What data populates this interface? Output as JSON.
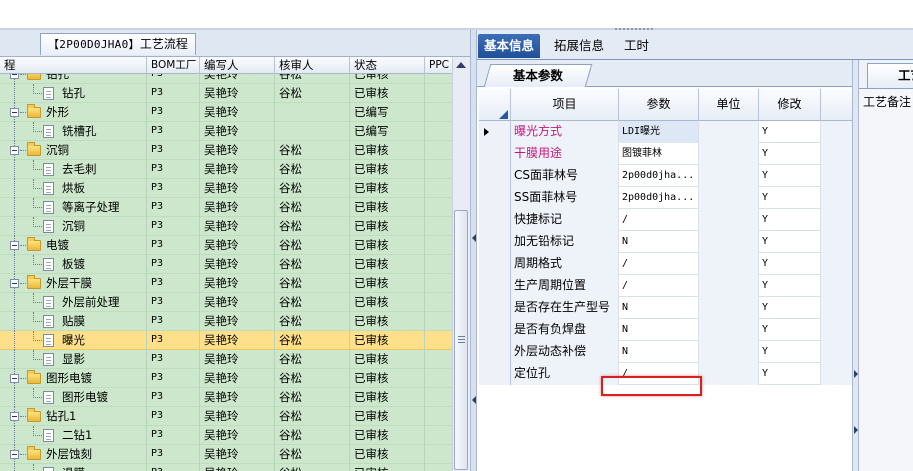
{
  "left_panel": {
    "title_code": "【2P00D0JHA0】",
    "title_text": "工艺流程",
    "columns": [
      "程",
      "BOM工厂",
      "编写人",
      "核审人",
      "状态",
      "PPC"
    ],
    "rows": [
      {
        "label": "钻孔",
        "type": "folder",
        "level": 0,
        "bom": "P3",
        "writer": "吴艳玲",
        "reviewer": "谷松",
        "status": "已审核",
        "selected": false
      },
      {
        "label": "钻孔",
        "type": "doc",
        "level": 1,
        "bom": "P3",
        "writer": "吴艳玲",
        "reviewer": "谷松",
        "status": "已审核",
        "selected": false
      },
      {
        "label": "外形",
        "type": "folder",
        "level": 0,
        "bom": "P3",
        "writer": "吴艳玲",
        "reviewer": "",
        "status": "已编写",
        "selected": false
      },
      {
        "label": "铣槽孔",
        "type": "doc",
        "level": 1,
        "bom": "P3",
        "writer": "吴艳玲",
        "reviewer": "",
        "status": "已编写",
        "selected": false
      },
      {
        "label": "沉铜",
        "type": "folder",
        "level": 0,
        "bom": "P3",
        "writer": "吴艳玲",
        "reviewer": "谷松",
        "status": "已审核",
        "selected": false
      },
      {
        "label": "去毛刺",
        "type": "doc",
        "level": 1,
        "bom": "P3",
        "writer": "吴艳玲",
        "reviewer": "谷松",
        "status": "已审核",
        "selected": false
      },
      {
        "label": "烘板",
        "type": "doc",
        "level": 1,
        "bom": "P3",
        "writer": "吴艳玲",
        "reviewer": "谷松",
        "status": "已审核",
        "selected": false
      },
      {
        "label": "等离子处理",
        "type": "doc",
        "level": 1,
        "bom": "P3",
        "writer": "吴艳玲",
        "reviewer": "谷松",
        "status": "已审核",
        "selected": false
      },
      {
        "label": "沉铜",
        "type": "doc",
        "level": 1,
        "bom": "P3",
        "writer": "吴艳玲",
        "reviewer": "谷松",
        "status": "已审核",
        "selected": false
      },
      {
        "label": "电镀",
        "type": "folder",
        "level": 0,
        "bom": "P3",
        "writer": "吴艳玲",
        "reviewer": "谷松",
        "status": "已审核",
        "selected": false
      },
      {
        "label": "板镀",
        "type": "doc",
        "level": 1,
        "bom": "P3",
        "writer": "吴艳玲",
        "reviewer": "谷松",
        "status": "已审核",
        "selected": false
      },
      {
        "label": "外层干膜",
        "type": "folder",
        "level": 0,
        "bom": "P3",
        "writer": "吴艳玲",
        "reviewer": "谷松",
        "status": "已审核",
        "selected": false
      },
      {
        "label": "外层前处理",
        "type": "doc",
        "level": 1,
        "bom": "P3",
        "writer": "吴艳玲",
        "reviewer": "谷松",
        "status": "已审核",
        "selected": false
      },
      {
        "label": "贴膜",
        "type": "doc",
        "level": 1,
        "bom": "P3",
        "writer": "吴艳玲",
        "reviewer": "谷松",
        "status": "已审核",
        "selected": false
      },
      {
        "label": "曝光",
        "type": "doc",
        "level": 1,
        "bom": "P3",
        "writer": "吴艳玲",
        "reviewer": "谷松",
        "status": "已审核",
        "selected": true
      },
      {
        "label": "显影",
        "type": "doc",
        "level": 1,
        "bom": "P3",
        "writer": "吴艳玲",
        "reviewer": "谷松",
        "status": "已审核",
        "selected": false
      },
      {
        "label": "图形电镀",
        "type": "folder",
        "level": 0,
        "bom": "P3",
        "writer": "吴艳玲",
        "reviewer": "谷松",
        "status": "已审核",
        "selected": false
      },
      {
        "label": "图形电镀",
        "type": "doc",
        "level": 1,
        "bom": "P3",
        "writer": "吴艳玲",
        "reviewer": "谷松",
        "status": "已审核",
        "selected": false
      },
      {
        "label": "钻孔1",
        "type": "folder",
        "level": 0,
        "bom": "P3",
        "writer": "吴艳玲",
        "reviewer": "谷松",
        "status": "已审核",
        "selected": false
      },
      {
        "label": "二钻1",
        "type": "doc",
        "level": 1,
        "bom": "P3",
        "writer": "吴艳玲",
        "reviewer": "谷松",
        "status": "已审核",
        "selected": false
      },
      {
        "label": "外层蚀刻",
        "type": "folder",
        "level": 0,
        "bom": "P3",
        "writer": "吴艳玲",
        "reviewer": "谷松",
        "status": "已审核",
        "selected": false
      },
      {
        "label": "退膜",
        "type": "doc",
        "level": 1,
        "bom": "P3",
        "writer": "吴艳玲",
        "reviewer": "谷松",
        "status": "已审核",
        "selected": false
      }
    ]
  },
  "right_panel": {
    "tabs": [
      "基本信息",
      "拓展信息",
      "工时"
    ],
    "active_tab": "基本信息",
    "sub_tab": "基本参数",
    "columns": [
      "项目",
      "参数",
      "单位",
      "修改"
    ],
    "rows": [
      {
        "item": "曝光方式",
        "value": "LDI曝光",
        "unit": "",
        "modify": "Y",
        "magenta": true,
        "current": true
      },
      {
        "item": "干膜用途",
        "value": "图镀菲林",
        "unit": "",
        "modify": "Y",
        "magenta": true,
        "current": false
      },
      {
        "item": "CS面菲林号",
        "value": "2p00d0jha...",
        "unit": "",
        "modify": "Y",
        "magenta": false,
        "current": false
      },
      {
        "item": "SS面菲林号",
        "value": "2p00d0jha...",
        "unit": "",
        "modify": "Y",
        "magenta": false,
        "current": false
      },
      {
        "item": "快捷标记",
        "value": "/",
        "unit": "",
        "modify": "Y",
        "magenta": false,
        "current": false
      },
      {
        "item": "加无铅标记",
        "value": "N",
        "unit": "",
        "modify": "Y",
        "magenta": false,
        "current": false
      },
      {
        "item": "周期格式",
        "value": "/",
        "unit": "",
        "modify": "Y",
        "magenta": false,
        "current": false
      },
      {
        "item": "生产周期位置",
        "value": "/",
        "unit": "",
        "modify": "Y",
        "magenta": false,
        "current": false
      },
      {
        "item": "是否存在生产型号",
        "value": "N",
        "unit": "",
        "modify": "Y",
        "magenta": false,
        "current": false
      },
      {
        "item": "是否有负焊盘",
        "value": "N",
        "unit": "",
        "modify": "Y",
        "magenta": false,
        "current": false
      },
      {
        "item": "外层动态补偿",
        "value": "N",
        "unit": "",
        "modify": "Y",
        "magenta": false,
        "current": false
      },
      {
        "item": "定位孔",
        "value": "/",
        "unit": "",
        "modify": "Y",
        "magenta": false,
        "current": false
      }
    ]
  },
  "far_right": {
    "tab_label": "工艺备注",
    "body_label": "工艺备注"
  },
  "colors": {
    "tree_row": "#cde7cc",
    "selected_row": "#fde089",
    "active_tab": "#2a5aa5",
    "magenta_label": "#c4177e",
    "highlight_outline": "#d62020"
  }
}
